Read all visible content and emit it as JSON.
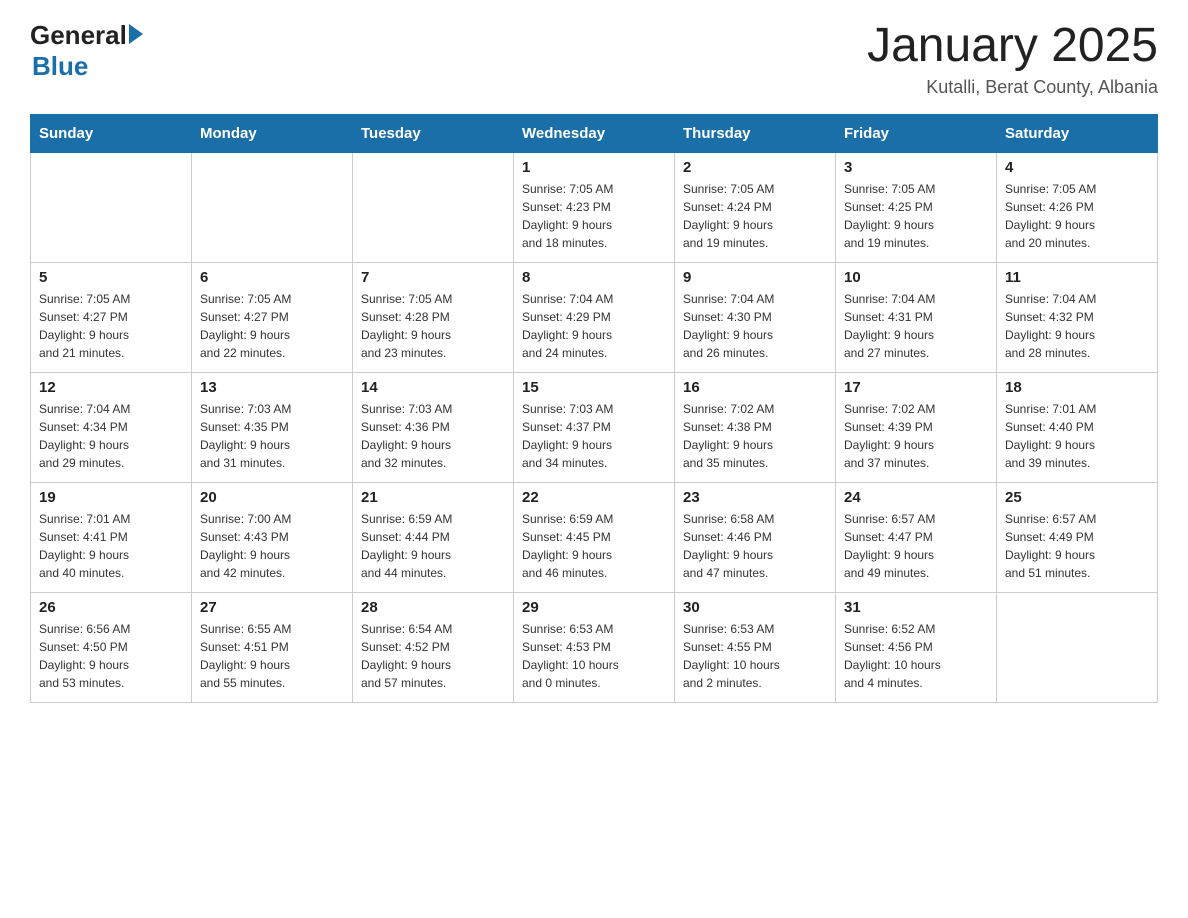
{
  "header": {
    "logo_general": "General",
    "logo_blue": "Blue",
    "title": "January 2025",
    "subtitle": "Kutalli, Berat County, Albania"
  },
  "weekdays": [
    "Sunday",
    "Monday",
    "Tuesday",
    "Wednesday",
    "Thursday",
    "Friday",
    "Saturday"
  ],
  "weeks": [
    [
      {
        "day": "",
        "info": ""
      },
      {
        "day": "",
        "info": ""
      },
      {
        "day": "",
        "info": ""
      },
      {
        "day": "1",
        "info": "Sunrise: 7:05 AM\nSunset: 4:23 PM\nDaylight: 9 hours\nand 18 minutes."
      },
      {
        "day": "2",
        "info": "Sunrise: 7:05 AM\nSunset: 4:24 PM\nDaylight: 9 hours\nand 19 minutes."
      },
      {
        "day": "3",
        "info": "Sunrise: 7:05 AM\nSunset: 4:25 PM\nDaylight: 9 hours\nand 19 minutes."
      },
      {
        "day": "4",
        "info": "Sunrise: 7:05 AM\nSunset: 4:26 PM\nDaylight: 9 hours\nand 20 minutes."
      }
    ],
    [
      {
        "day": "5",
        "info": "Sunrise: 7:05 AM\nSunset: 4:27 PM\nDaylight: 9 hours\nand 21 minutes."
      },
      {
        "day": "6",
        "info": "Sunrise: 7:05 AM\nSunset: 4:27 PM\nDaylight: 9 hours\nand 22 minutes."
      },
      {
        "day": "7",
        "info": "Sunrise: 7:05 AM\nSunset: 4:28 PM\nDaylight: 9 hours\nand 23 minutes."
      },
      {
        "day": "8",
        "info": "Sunrise: 7:04 AM\nSunset: 4:29 PM\nDaylight: 9 hours\nand 24 minutes."
      },
      {
        "day": "9",
        "info": "Sunrise: 7:04 AM\nSunset: 4:30 PM\nDaylight: 9 hours\nand 26 minutes."
      },
      {
        "day": "10",
        "info": "Sunrise: 7:04 AM\nSunset: 4:31 PM\nDaylight: 9 hours\nand 27 minutes."
      },
      {
        "day": "11",
        "info": "Sunrise: 7:04 AM\nSunset: 4:32 PM\nDaylight: 9 hours\nand 28 minutes."
      }
    ],
    [
      {
        "day": "12",
        "info": "Sunrise: 7:04 AM\nSunset: 4:34 PM\nDaylight: 9 hours\nand 29 minutes."
      },
      {
        "day": "13",
        "info": "Sunrise: 7:03 AM\nSunset: 4:35 PM\nDaylight: 9 hours\nand 31 minutes."
      },
      {
        "day": "14",
        "info": "Sunrise: 7:03 AM\nSunset: 4:36 PM\nDaylight: 9 hours\nand 32 minutes."
      },
      {
        "day": "15",
        "info": "Sunrise: 7:03 AM\nSunset: 4:37 PM\nDaylight: 9 hours\nand 34 minutes."
      },
      {
        "day": "16",
        "info": "Sunrise: 7:02 AM\nSunset: 4:38 PM\nDaylight: 9 hours\nand 35 minutes."
      },
      {
        "day": "17",
        "info": "Sunrise: 7:02 AM\nSunset: 4:39 PM\nDaylight: 9 hours\nand 37 minutes."
      },
      {
        "day": "18",
        "info": "Sunrise: 7:01 AM\nSunset: 4:40 PM\nDaylight: 9 hours\nand 39 minutes."
      }
    ],
    [
      {
        "day": "19",
        "info": "Sunrise: 7:01 AM\nSunset: 4:41 PM\nDaylight: 9 hours\nand 40 minutes."
      },
      {
        "day": "20",
        "info": "Sunrise: 7:00 AM\nSunset: 4:43 PM\nDaylight: 9 hours\nand 42 minutes."
      },
      {
        "day": "21",
        "info": "Sunrise: 6:59 AM\nSunset: 4:44 PM\nDaylight: 9 hours\nand 44 minutes."
      },
      {
        "day": "22",
        "info": "Sunrise: 6:59 AM\nSunset: 4:45 PM\nDaylight: 9 hours\nand 46 minutes."
      },
      {
        "day": "23",
        "info": "Sunrise: 6:58 AM\nSunset: 4:46 PM\nDaylight: 9 hours\nand 47 minutes."
      },
      {
        "day": "24",
        "info": "Sunrise: 6:57 AM\nSunset: 4:47 PM\nDaylight: 9 hours\nand 49 minutes."
      },
      {
        "day": "25",
        "info": "Sunrise: 6:57 AM\nSunset: 4:49 PM\nDaylight: 9 hours\nand 51 minutes."
      }
    ],
    [
      {
        "day": "26",
        "info": "Sunrise: 6:56 AM\nSunset: 4:50 PM\nDaylight: 9 hours\nand 53 minutes."
      },
      {
        "day": "27",
        "info": "Sunrise: 6:55 AM\nSunset: 4:51 PM\nDaylight: 9 hours\nand 55 minutes."
      },
      {
        "day": "28",
        "info": "Sunrise: 6:54 AM\nSunset: 4:52 PM\nDaylight: 9 hours\nand 57 minutes."
      },
      {
        "day": "29",
        "info": "Sunrise: 6:53 AM\nSunset: 4:53 PM\nDaylight: 10 hours\nand 0 minutes."
      },
      {
        "day": "30",
        "info": "Sunrise: 6:53 AM\nSunset: 4:55 PM\nDaylight: 10 hours\nand 2 minutes."
      },
      {
        "day": "31",
        "info": "Sunrise: 6:52 AM\nSunset: 4:56 PM\nDaylight: 10 hours\nand 4 minutes."
      },
      {
        "day": "",
        "info": ""
      }
    ]
  ]
}
